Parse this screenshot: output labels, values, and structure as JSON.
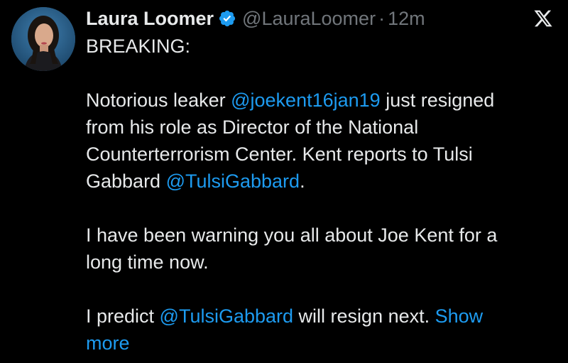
{
  "user": {
    "display_name": "Laura Loomer",
    "handle": "@LauraLoomer",
    "separator": "·",
    "time": "12m"
  },
  "icons": {
    "verified": "verified-badge-icon",
    "platform": "x-logo-icon"
  },
  "colors": {
    "background": "#000000",
    "text": "#e7e9ea",
    "muted": "#71767b",
    "accent": "#1d9bf0"
  },
  "tweet": {
    "line1": "BREAKING:",
    "p2_a": "Notorious leaker ",
    "p2_mention1": "@joekent16jan19",
    "p2_b": " just resigned",
    "p2_c": "from his role as Director of the National",
    "p2_d": "Counterterrorism Center. Kent reports to Tulsi",
    "p2_e": "Gabbard ",
    "p2_mention2": "@TulsiGabbard",
    "p2_f": ".",
    "p3_a": "I have been warning you all about Joe Kent for a",
    "p3_b": "long time now.",
    "p4_a": "I predict ",
    "p4_mention": "@TulsiGabbard",
    "p4_b": " will resign next. ",
    "show_more_1": "Show",
    "show_more_2": "more"
  }
}
